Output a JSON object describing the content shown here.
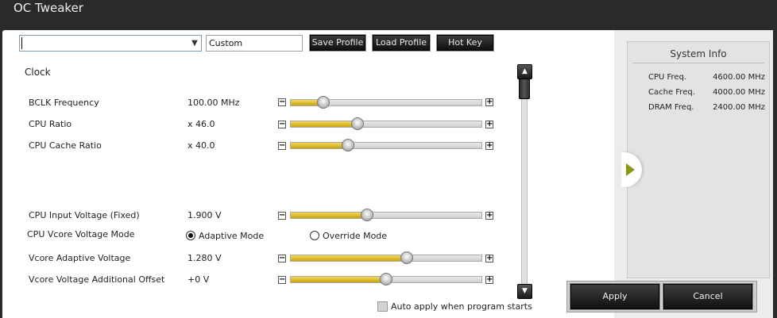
{
  "window": {
    "title": "OC Tweaker"
  },
  "toolbar": {
    "profile_select_value": "",
    "profile_name_value": "Custom",
    "save_label": "Save Profile",
    "load_label": "Load Profile",
    "hotkey_label": "Hot Key"
  },
  "clock": {
    "title": "Clock",
    "rows": [
      {
        "label": "BCLK Frequency",
        "value": "100.00 MHz",
        "level": 0.17
      },
      {
        "label": "CPU Ratio",
        "value": "x 46.0",
        "level": 0.35
      },
      {
        "label": "CPU Cache Ratio",
        "value": "x 40.0",
        "level": 0.3
      }
    ]
  },
  "voltage": {
    "input_voltage": {
      "label": "CPU Input Voltage (Fixed)",
      "value": "1.900 V",
      "level": 0.4
    },
    "mode": {
      "label": "CPU Vcore Voltage Mode",
      "options": [
        "Adaptive Mode",
        "Override Mode"
      ],
      "selected": "Adaptive Mode"
    },
    "adaptive": {
      "label": "Vcore Adaptive Voltage",
      "value": "1.280 V",
      "level": 0.61
    },
    "offset": {
      "label": "Vcore Voltage Additional Offset",
      "value": "+0 V",
      "level": 0.5
    }
  },
  "auto_apply": {
    "label": "Auto apply when program starts",
    "checked": false
  },
  "system_info": {
    "title": "System Info",
    "rows": [
      {
        "key": "CPU Freq.",
        "value": "4600.00 MHz"
      },
      {
        "key": "Cache Freq.",
        "value": "4000.00 MHz"
      },
      {
        "key": "DRAM Freq.",
        "value": "2400.00 MHz"
      }
    ]
  },
  "actions": {
    "apply_label": "Apply",
    "cancel_label": "Cancel"
  },
  "colors": {
    "slider_fill": "#e0c02a",
    "button_dark": "#1a1a1a",
    "expander_arrow": "#8a9a10"
  }
}
